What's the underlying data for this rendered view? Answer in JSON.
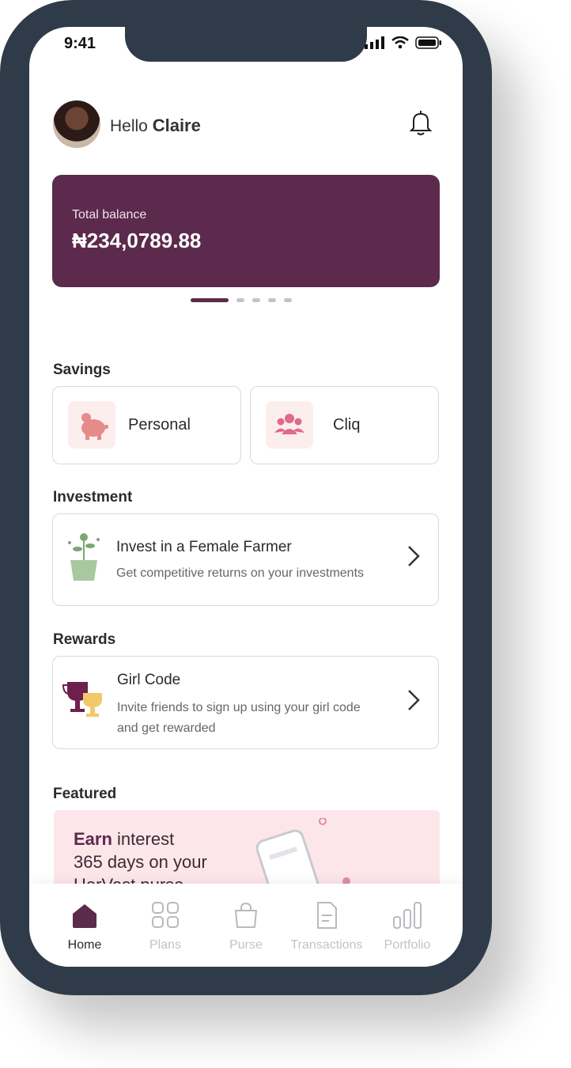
{
  "status": {
    "time": "9:41"
  },
  "header": {
    "greeting": "Hello",
    "name": "Claire"
  },
  "balance": {
    "label": "Total balance",
    "value": "₦234,0789.88"
  },
  "carousel": {
    "pages": 5,
    "active": 1
  },
  "savings": {
    "title": "Savings",
    "items": [
      {
        "label": "Personal",
        "icon": "piggy-bank-icon"
      },
      {
        "label": "Cliq",
        "icon": "group-icon"
      }
    ]
  },
  "investment": {
    "title": "Investment",
    "item": {
      "title": "Invest in a Female Farmer",
      "subtitle": "Get competitive returns on your investments",
      "icon": "plant-icon"
    }
  },
  "rewards": {
    "title": "Rewards",
    "item": {
      "title": "Girl Code",
      "subtitle_line1": "Invite friends to sign up using your girl code",
      "subtitle_line2": "and get rewarded",
      "icon": "trophy-icon"
    }
  },
  "featured": {
    "title": "Featured",
    "banner": {
      "bold": "Earn",
      "line1_rest": " interest",
      "line2": "365 days on your",
      "line3": "HerVest purse"
    }
  },
  "tabs": [
    {
      "label": "Home",
      "icon": "home-icon",
      "active": true
    },
    {
      "label": "Plans",
      "icon": "grid-icon",
      "active": false
    },
    {
      "label": "Purse",
      "icon": "bag-icon",
      "active": false
    },
    {
      "label": "Transactions",
      "icon": "document-icon",
      "active": false
    },
    {
      "label": "Portfolio",
      "icon": "bar-chart-icon",
      "active": false
    }
  ],
  "colors": {
    "brand": "#5b2a4c",
    "frame": "#2f3b48",
    "tile_bg": "#fdeeee",
    "accent_pink": "#e06a8a"
  }
}
